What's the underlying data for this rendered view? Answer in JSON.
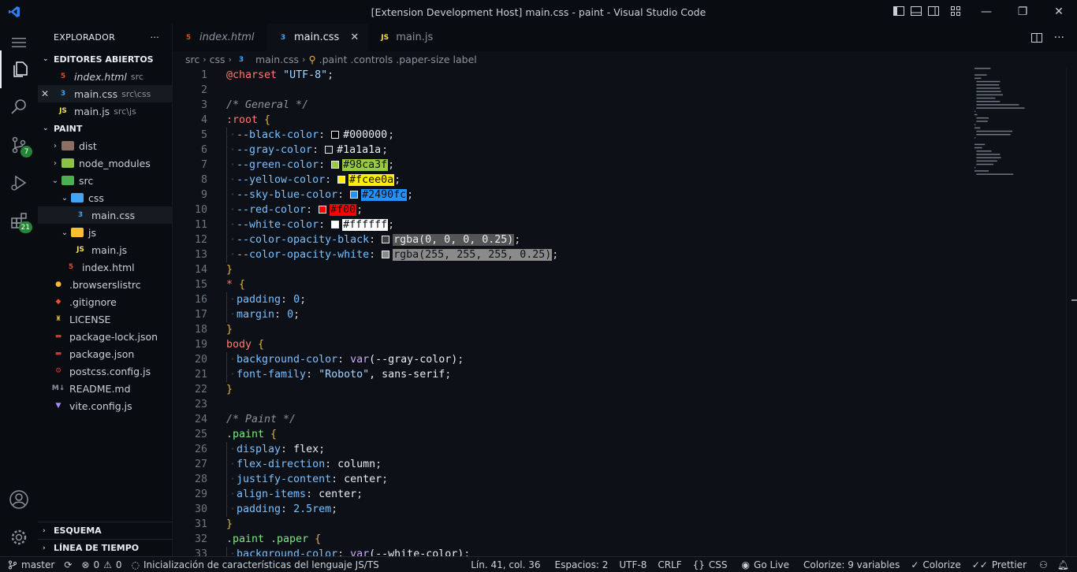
{
  "window": {
    "title": "[Extension Development Host] main.css - paint - Visual Studio Code",
    "minimize": "—",
    "restore": "❐",
    "close": "✕"
  },
  "activity": {
    "scm_badge": "7",
    "ext_badge": "21"
  },
  "sidebar": {
    "header": "EXPLORADOR",
    "more": "···",
    "open_editors": {
      "title": "EDITORES ABIERTOS",
      "items": [
        {
          "name": "index.html",
          "desc": "src",
          "type": "html",
          "close": ""
        },
        {
          "name": "main.css",
          "desc": "src\\css",
          "type": "css",
          "close": "✕"
        },
        {
          "name": "main.js",
          "desc": "src\\js",
          "type": "js",
          "close": ""
        }
      ]
    },
    "project": {
      "title": "PAINT",
      "items": [
        {
          "name": "dist",
          "type": "folder",
          "depth": 1,
          "chev": "›"
        },
        {
          "name": "node_modules",
          "type": "folder",
          "depth": 1,
          "chev": "›"
        },
        {
          "name": "src",
          "type": "folder",
          "depth": 1,
          "chev": "⌄"
        },
        {
          "name": "css",
          "type": "folder",
          "depth": 2,
          "chev": "⌄"
        },
        {
          "name": "main.css",
          "type": "css",
          "depth": 3,
          "chev": ""
        },
        {
          "name": "js",
          "type": "folder",
          "depth": 2,
          "chev": "⌄"
        },
        {
          "name": "main.js",
          "type": "js",
          "depth": 3,
          "chev": ""
        },
        {
          "name": "index.html",
          "type": "html",
          "depth": 2,
          "chev": ""
        },
        {
          "name": ".browserslistrc",
          "type": "browserslist",
          "depth": 1,
          "chev": ""
        },
        {
          "name": ".gitignore",
          "type": "git",
          "depth": 1,
          "chev": ""
        },
        {
          "name": "LICENSE",
          "type": "license",
          "depth": 1,
          "chev": ""
        },
        {
          "name": "package-lock.json",
          "type": "npm",
          "depth": 1,
          "chev": ""
        },
        {
          "name": "package.json",
          "type": "npm",
          "depth": 1,
          "chev": ""
        },
        {
          "name": "postcss.config.js",
          "type": "postcss",
          "depth": 1,
          "chev": ""
        },
        {
          "name": "README.md",
          "type": "md",
          "depth": 1,
          "chev": ""
        },
        {
          "name": "vite.config.js",
          "type": "vite",
          "depth": 1,
          "chev": ""
        }
      ]
    },
    "outline": "ESQUEMA",
    "timeline": "LÍNEA DE TIEMPO"
  },
  "tabs": [
    {
      "label": "index.html",
      "type": "html",
      "active": false,
      "italic": true
    },
    {
      "label": "main.css",
      "type": "css",
      "active": true,
      "italic": false
    },
    {
      "label": "main.js",
      "type": "js",
      "active": false,
      "italic": false
    }
  ],
  "breadcrumb": [
    "src",
    "css",
    "main.css",
    ".paint .controls .paper-size label"
  ],
  "code": [
    {
      "n": "1",
      "t": "@charset \"UTF-8\";"
    },
    {
      "n": "2",
      "t": ""
    },
    {
      "n": "3",
      "t": "/* General */"
    },
    {
      "n": "4",
      "t": ":root {"
    },
    {
      "n": "5",
      "t": "  --black-color: #000000;",
      "sw": "#000000"
    },
    {
      "n": "6",
      "t": "  --gray-color: #1a1a1a;",
      "sw": "#1a1a1a"
    },
    {
      "n": "7",
      "t": "  --green-color: #98ca3f;",
      "sw": "#98ca3f"
    },
    {
      "n": "8",
      "t": "  --yellow-color: #fcee0a;",
      "sw": "#fcee0a"
    },
    {
      "n": "9",
      "t": "  --sky-blue-color: #2490fc;",
      "sw": "#2490fc"
    },
    {
      "n": "10",
      "t": "  --red-color: #f00;",
      "sw": "#ff0000"
    },
    {
      "n": "11",
      "t": "  --white-color: #ffffff;",
      "sw": "#ffffff"
    },
    {
      "n": "12",
      "t": "  --color-opacity-black: rgba(0, 0, 0, 0.25);",
      "sw": "#404040"
    },
    {
      "n": "13",
      "t": "  --color-opacity-white: rgba(255, 255, 255, 0.25);",
      "sw": "#8a8a8a"
    },
    {
      "n": "14",
      "t": "}"
    },
    {
      "n": "15",
      "t": "* {"
    },
    {
      "n": "16",
      "t": "  padding: 0;"
    },
    {
      "n": "17",
      "t": "  margin: 0;"
    },
    {
      "n": "18",
      "t": "}"
    },
    {
      "n": "19",
      "t": "body {"
    },
    {
      "n": "20",
      "t": "  background-color: var(--gray-color);"
    },
    {
      "n": "21",
      "t": "  font-family: \"Roboto\", sans-serif;"
    },
    {
      "n": "22",
      "t": "}"
    },
    {
      "n": "23",
      "t": ""
    },
    {
      "n": "24",
      "t": "/* Paint */"
    },
    {
      "n": "25",
      "t": ".paint {"
    },
    {
      "n": "26",
      "t": "  display: flex;"
    },
    {
      "n": "27",
      "t": "  flex-direction: column;"
    },
    {
      "n": "28",
      "t": "  justify-content: center;"
    },
    {
      "n": "29",
      "t": "  align-items: center;"
    },
    {
      "n": "30",
      "t": "  padding: 2.5rem;"
    },
    {
      "n": "31",
      "t": "}"
    },
    {
      "n": "32",
      "t": ".paint .paper {"
    },
    {
      "n": "33",
      "t": "  background-color: var(--white-color);"
    }
  ],
  "status": {
    "branch": "master",
    "errors": "0",
    "warnings": "0",
    "task": "Inicialización de características del lenguaje JS/TS",
    "position": "Lín. 41, col. 36",
    "indent": "Espacios: 2",
    "encoding": "UTF-8",
    "eol": "CRLF",
    "lang": "CSS",
    "golive": "Go Live",
    "colorize_vars": "Colorize: 9 variables",
    "colorize": "Colorize",
    "prettier": "Prettier"
  }
}
